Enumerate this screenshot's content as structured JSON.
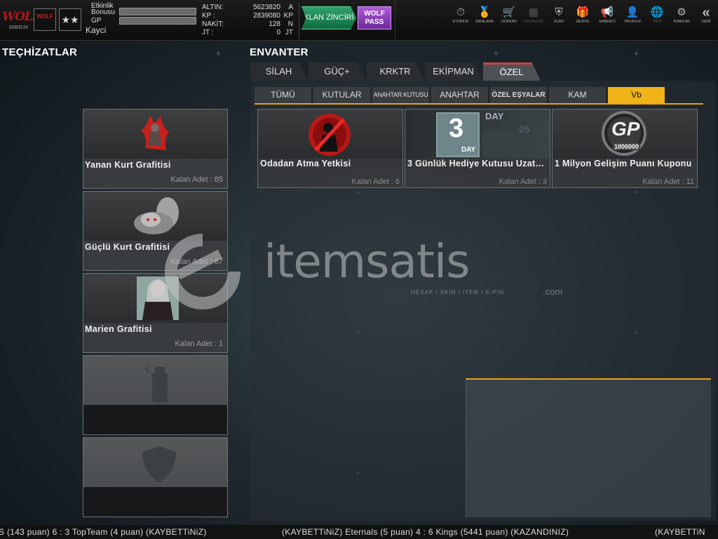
{
  "header": {
    "logo_text": "WOLF",
    "logo_sub": "DIRILIS",
    "badge1_text": "WOLF",
    "badge2_text": "★★",
    "bonus_label": "Etkinlik Bonusu",
    "gp_label": "GP",
    "username": "Kayci",
    "currencies": [
      {
        "label": "ALTIN:",
        "value": "5623820",
        "unit": "A"
      },
      {
        "label": "KP  :",
        "value": "2839080",
        "unit": "KP"
      },
      {
        "label": "NAKİT:",
        "value": "128",
        "unit": "N"
      },
      {
        "label": "JT  :",
        "value": "0",
        "unit": "JT"
      }
    ],
    "klan_button": "KLAN ZİNCİRİ",
    "wolf_pass_button": "WOLF PASS"
  },
  "nav": [
    {
      "label": "ETKİNLİK",
      "icon": "timer-icon",
      "glyph": "⏱"
    },
    {
      "label": "SIRALAMA",
      "icon": "medal-icon",
      "glyph": "🏅"
    },
    {
      "label": "DÜKKAN",
      "icon": "cart-icon",
      "glyph": "🛒"
    },
    {
      "label": "ENVANTER",
      "icon": "inventory-icon",
      "glyph": "▦"
    },
    {
      "label": "KLAN",
      "icon": "shield-icon",
      "glyph": "⛨"
    },
    {
      "label": "HEDİYE",
      "icon": "gift-icon",
      "glyph": "🎁"
    },
    {
      "label": "HABERCİ",
      "icon": "megaphone-icon",
      "glyph": "📢"
    },
    {
      "label": "PROFİLM",
      "icon": "profile-icon",
      "glyph": "👤"
    },
    {
      "label": "WEB",
      "icon": "globe-icon",
      "glyph": "🌐"
    },
    {
      "label": "AYARLAR",
      "icon": "gear-icon",
      "glyph": "⚙"
    },
    {
      "label": "GERİ",
      "icon": "back-icon",
      "glyph": "«"
    }
  ],
  "equipment": {
    "title": "TEÇHİZATLAR",
    "slots": [
      {
        "name": "Yanan Kurt Grafitisi",
        "count": "Kalan Adet : 85"
      },
      {
        "name": "Güçlü Kurt Grafitisi",
        "count": "Kalan Adet : 87"
      },
      {
        "name": "Marien Grafitisi",
        "count": "Kalan Adet : 1"
      }
    ]
  },
  "inventory": {
    "title": "ENVANTER",
    "tabs": [
      "SİLAH",
      "GÜÇ+",
      "KRKTR",
      "EKİPMAN",
      "ÖZEL"
    ],
    "active_tab": "ÖZEL",
    "subtabs": [
      "TÜMÜ",
      "KUTULAR",
      "ANAHTAR KUTUSU",
      "ANAHTAR",
      "ÖZEL EŞYALAR",
      "KAM",
      "Vb"
    ],
    "active_subtab": "Vb",
    "items": [
      {
        "name": "Odadan Atma Yetkisi",
        "count": "Kalan Adet : 6"
      },
      {
        "name": "3 Günlük Hediye Kutusu Uzatma",
        "count": "Kalan Adet : 3",
        "img_big": "3",
        "img_day": "DAY",
        "img_day2": "DAY",
        "img_05": "05"
      },
      {
        "name": "1 Milyon Gelişim Puanı Kuponu",
        "count": "Kalan Adet : 11",
        "img_gp": "GP",
        "img_amount": "1000000"
      }
    ]
  },
  "watermark": {
    "text": "itemsatis",
    "sub": "HESAP / SKIN / ITEM / E-PIN",
    "com": ".com"
  },
  "ticker": {
    "segments": [
      "S (143 puan) 6 : 3 TopTeam (4 puan) (KAYBETTiNiZ)",
      "(KAYBETTiNiZ) Eternals (5 puan) 4 : 6 Kings (5441 puan) (KAZANDINIZ)",
      "(KAYBETTiN"
    ]
  },
  "colors": {
    "accent": "#f0b418",
    "tab_active_marker": "#cc4444",
    "klan_green": "#1f8a55",
    "wolf_purple": "#9a48c8"
  }
}
